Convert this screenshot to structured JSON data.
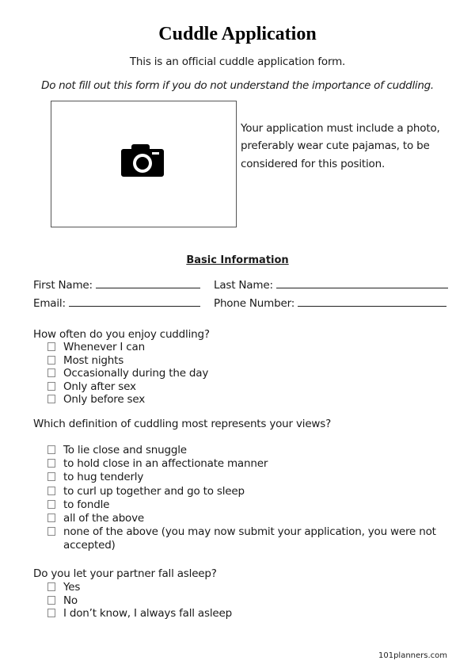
{
  "header": {
    "title": "Cuddle Application",
    "subtitle": "This is an official cuddle application form.",
    "warning": "Do not fill out this form if you do not understand the importance of cuddling."
  },
  "photo": {
    "icon": "camera-icon",
    "note": "Your application must include a photo, preferably wear cute pajamas, to be considered for this position."
  },
  "basic_info": {
    "heading": "Basic Information",
    "fields": {
      "first_name": {
        "label": "First Name:",
        "value": ""
      },
      "last_name": {
        "label": "Last Name:",
        "value": ""
      },
      "email": {
        "label": "Email:",
        "value": ""
      },
      "phone": {
        "label": "Phone Number:",
        "value": ""
      }
    }
  },
  "questions": [
    {
      "question": "How often do you enjoy cuddling?",
      "options": [
        "Whenever I can",
        "Most nights",
        "Occasionally during the day",
        "Only after sex",
        "Only before sex"
      ]
    },
    {
      "question": "Which definition of cuddling most represents your views?",
      "options": [
        "To lie close and snuggle",
        "to hold close in an affectionate manner",
        "to hug tenderly",
        "to curl up together and go to sleep",
        "to fondle",
        "all of the above",
        "none of the above (you may now submit your application, you were not",
        "accepted)"
      ]
    },
    {
      "question": "Do you let your partner fall asleep?",
      "options": [
        "Yes",
        "No",
        "I don’t know, I always fall asleep"
      ]
    }
  ],
  "footer": {
    "site": "101planners.com"
  }
}
